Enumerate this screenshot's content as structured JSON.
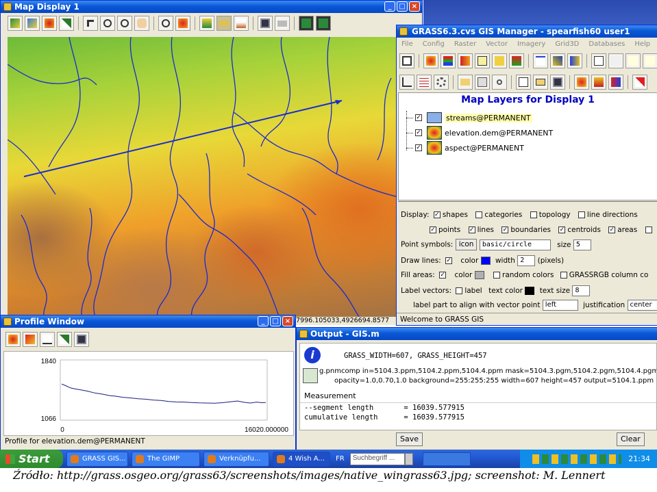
{
  "map_display": {
    "title": "Map Display 1",
    "coords": "7996.105033,4926694.8577"
  },
  "gis_manager": {
    "title": "GRASS6.3.cvs GIS Manager - spearfish60 user1",
    "menu": [
      "File",
      "Config",
      "Raster",
      "Vector",
      "Imagery",
      "Grid3D",
      "Databases",
      "Help"
    ],
    "layers_heading": "Map Layers for Display 1",
    "layers": [
      {
        "name": "streams@PERMANENT",
        "checked": true
      },
      {
        "name": "elevation.dem@PERMANENT",
        "checked": true
      },
      {
        "name": "aspect@PERMANENT",
        "checked": true
      }
    ],
    "display_label": "Display:",
    "display_opts": [
      "shapes",
      "categories",
      "topology",
      "line directions"
    ],
    "display_opts_checked": [
      true,
      false,
      false,
      false
    ],
    "feature_opts": [
      "points",
      "lines",
      "boundaries",
      "centroids",
      "areas"
    ],
    "point_symbols_label": "Point symbols:",
    "icon_button": "icon",
    "icon_value": "basic/circle",
    "size_label": "size",
    "size_value": "5",
    "draw_lines_label": "Draw lines:",
    "color_label": "color",
    "width_label": "width",
    "width_value": "2",
    "pixels_label": "(pixels)",
    "fill_areas_label": "Fill areas:",
    "random_colors_label": "random colors",
    "grassrgb_label": "GRASSRGB column co",
    "label_vectors_label": "Label vectors:",
    "label_label": "label",
    "text_color_label": "text color",
    "text_size_label": "text size",
    "text_size_value": "8",
    "label_part_label": "label part to align with vector point",
    "label_part_value": "left",
    "justification_label": "justification",
    "justification_value": "center",
    "status": "Welcome to GRASS GIS",
    "line_color": "#0000ff"
  },
  "profile_window": {
    "title": "Profile Window",
    "status": "Profile for elevation.dem@PERMANENT"
  },
  "chart_data": {
    "type": "line",
    "title": "",
    "xlabel": "",
    "ylabel": "",
    "y_ticks": [
      "1840",
      "1066"
    ],
    "x_ticks": [
      "0",
      "16020.000000"
    ],
    "xlim": [
      0,
      16020
    ],
    "ylim": [
      1066,
      1840
    ],
    "series": [
      {
        "x": [
          0,
          300,
          700,
          1000,
          1500,
          2000,
          2600,
          3200,
          3800,
          4200,
          4800,
          5400,
          6000,
          6600,
          7200,
          7800,
          8400,
          9000,
          9600,
          10200,
          10800,
          11400,
          12000,
          12600,
          13200,
          13800,
          14300,
          14800,
          15300,
          15700,
          16020
        ],
        "values": [
          1530,
          1510,
          1480,
          1470,
          1455,
          1440,
          1415,
          1400,
          1380,
          1375,
          1360,
          1352,
          1340,
          1335,
          1325,
          1318,
          1305,
          1300,
          1298,
          1292,
          1288,
          1286,
          1284,
          1290,
          1302,
          1312,
          1296,
          1286,
          1298,
          1290,
          1292
        ]
      }
    ]
  },
  "output": {
    "title": "Output - GIS.m",
    "line1": "GRASS_WIDTH=607, GRASS_HEIGHT=457",
    "cmd1": "g.pnmcomp in=5104.3.ppm,5104.2.ppm,5104.4.ppm mask=5104.3.pgm,5104.2.pgm,5104.4.pgm",
    "cmd2": "opacity=1.0,0.70,1.0 background=255:255:255 width=607 height=457 output=5104.1.ppm",
    "measurement": "Measurement",
    "seg": "--segment length       = 16039.577915",
    "cum": "cumulative length      = 16039.577915",
    "save": "Save",
    "clear": "Clear"
  },
  "taskbar": {
    "start": "Start",
    "tasks": [
      "GRASS GIS...",
      "The GIMP",
      "Verknüpfu...",
      "4 Wish A..."
    ],
    "lang": "FR",
    "search_placeholder": "Suchbegriff ...",
    "clock": "21:34"
  },
  "caption": "Źródło: http://grass.osgeo.org/grass63/screenshots/images/native_wingrass63.jpg; screenshot: M. Lennert"
}
